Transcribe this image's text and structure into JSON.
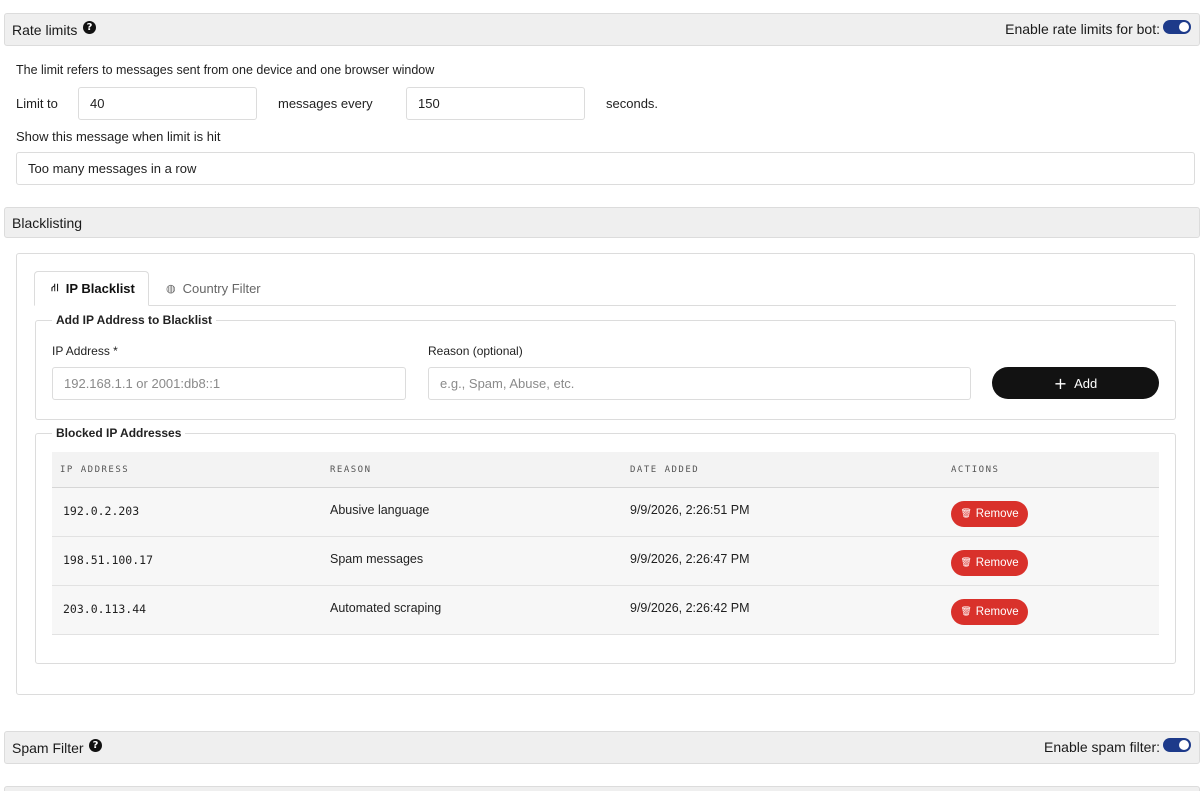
{
  "rate_limits": {
    "title": "Rate limits",
    "help_icon": "question-circle-icon",
    "toggle_label": "Enable rate limits for bot:",
    "toggle_on": true,
    "description": "The limit refers to messages sent from one device and one browser window",
    "limit_to_label": "Limit to",
    "limit_value": "40",
    "messages_every_label": "messages every",
    "seconds_value": "150",
    "seconds_label": "seconds.",
    "message_label": "Show this message when limit is hit",
    "message_value": "Too many messages in a row"
  },
  "blacklisting": {
    "title": "Blacklisting",
    "tabs": [
      {
        "label": "IP Blacklist",
        "icon": "network-icon",
        "active": true
      },
      {
        "label": "Country Filter",
        "icon": "globe-icon",
        "active": false
      }
    ],
    "add_group": {
      "legend": "Add IP Address to Blacklist",
      "ip_label": "IP Address *",
      "ip_placeholder": "192.168.1.1 or 2001:db8::1",
      "reason_label": "Reason (optional)",
      "reason_placeholder": "e.g., Spam, Abuse, etc.",
      "add_button": "Add"
    },
    "blocked_group": {
      "legend": "Blocked IP Addresses",
      "columns": [
        "IP ADDRESS",
        "REASON",
        "DATE ADDED",
        "ACTIONS"
      ],
      "rows": [
        {
          "ip": "192.0.2.203",
          "reason": "Abusive language",
          "date": "9/9/2026, 2:26:51 PM",
          "action": "Remove"
        },
        {
          "ip": "198.51.100.17",
          "reason": "Spam messages",
          "date": "9/9/2026, 2:26:47 PM",
          "action": "Remove"
        },
        {
          "ip": "203.0.113.44",
          "reason": "Automated scraping",
          "date": "9/9/2026, 2:26:42 PM",
          "action": "Remove"
        }
      ]
    }
  },
  "spam_filter": {
    "title": "Spam Filter",
    "toggle_label": "Enable spam filter:",
    "toggle_on": true
  },
  "colors": {
    "toggle_accent": "#1d3a8a",
    "remove_button": "#d9312b",
    "add_button": "#121212"
  }
}
